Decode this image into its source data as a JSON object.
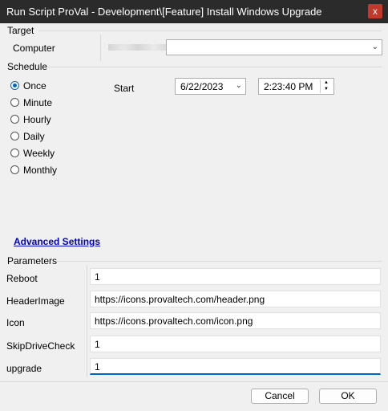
{
  "window": {
    "title": "Run Script ProVal - Development\\[Feature] Install Windows Upgrade",
    "close": "x"
  },
  "target": {
    "section": "Target",
    "computer_label": "Computer"
  },
  "schedule": {
    "section": "Schedule",
    "options": [
      "Once",
      "Minute",
      "Hourly",
      "Daily",
      "Weekly",
      "Monthly"
    ],
    "selected": "Once",
    "start_label": "Start",
    "start_date": "6/22/2023",
    "start_time": "2:23:40 PM"
  },
  "advanced_settings": "Advanced Settings",
  "parameters": {
    "section": "Parameters",
    "rows": [
      {
        "label": "Reboot",
        "value": "1"
      },
      {
        "label": "HeaderImage",
        "value": "https://icons.provaltech.com/header.png"
      },
      {
        "label": "Icon",
        "value": "https://icons.provaltech.com/icon.png"
      },
      {
        "label": "SkipDriveCheck",
        "value": "1"
      },
      {
        "label": "upgrade",
        "value": "1"
      }
    ]
  },
  "buttons": {
    "cancel": "Cancel",
    "ok": "OK"
  },
  "colors": {
    "titlebar": "#2b2b2b",
    "close": "#c0392b",
    "accent": "#0067c0",
    "link": "#0000cc"
  }
}
